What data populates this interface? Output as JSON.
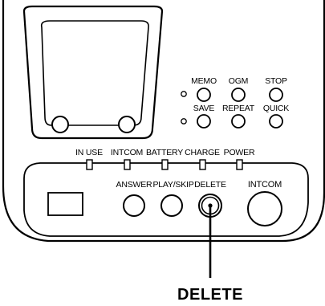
{
  "panel": {
    "mode_buttons": [
      {
        "label": "MEMO"
      },
      {
        "label": "OGM"
      },
      {
        "label": "STOP"
      },
      {
        "label": "SAVE"
      },
      {
        "label": "REPEAT"
      },
      {
        "label": "QUICK"
      }
    ],
    "indicators": [
      {
        "label": "IN USE"
      },
      {
        "label": "INTCOM"
      },
      {
        "label": "BATTERY"
      },
      {
        "label": "CHARGE"
      },
      {
        "label": "POWER"
      }
    ],
    "bottom_buttons": [
      {
        "label": "ANSWER"
      },
      {
        "label": "PLAY/SKIP"
      },
      {
        "label": "DELETE"
      },
      {
        "label": "INTCOM"
      }
    ]
  },
  "callout": {
    "label": "DELETE"
  }
}
